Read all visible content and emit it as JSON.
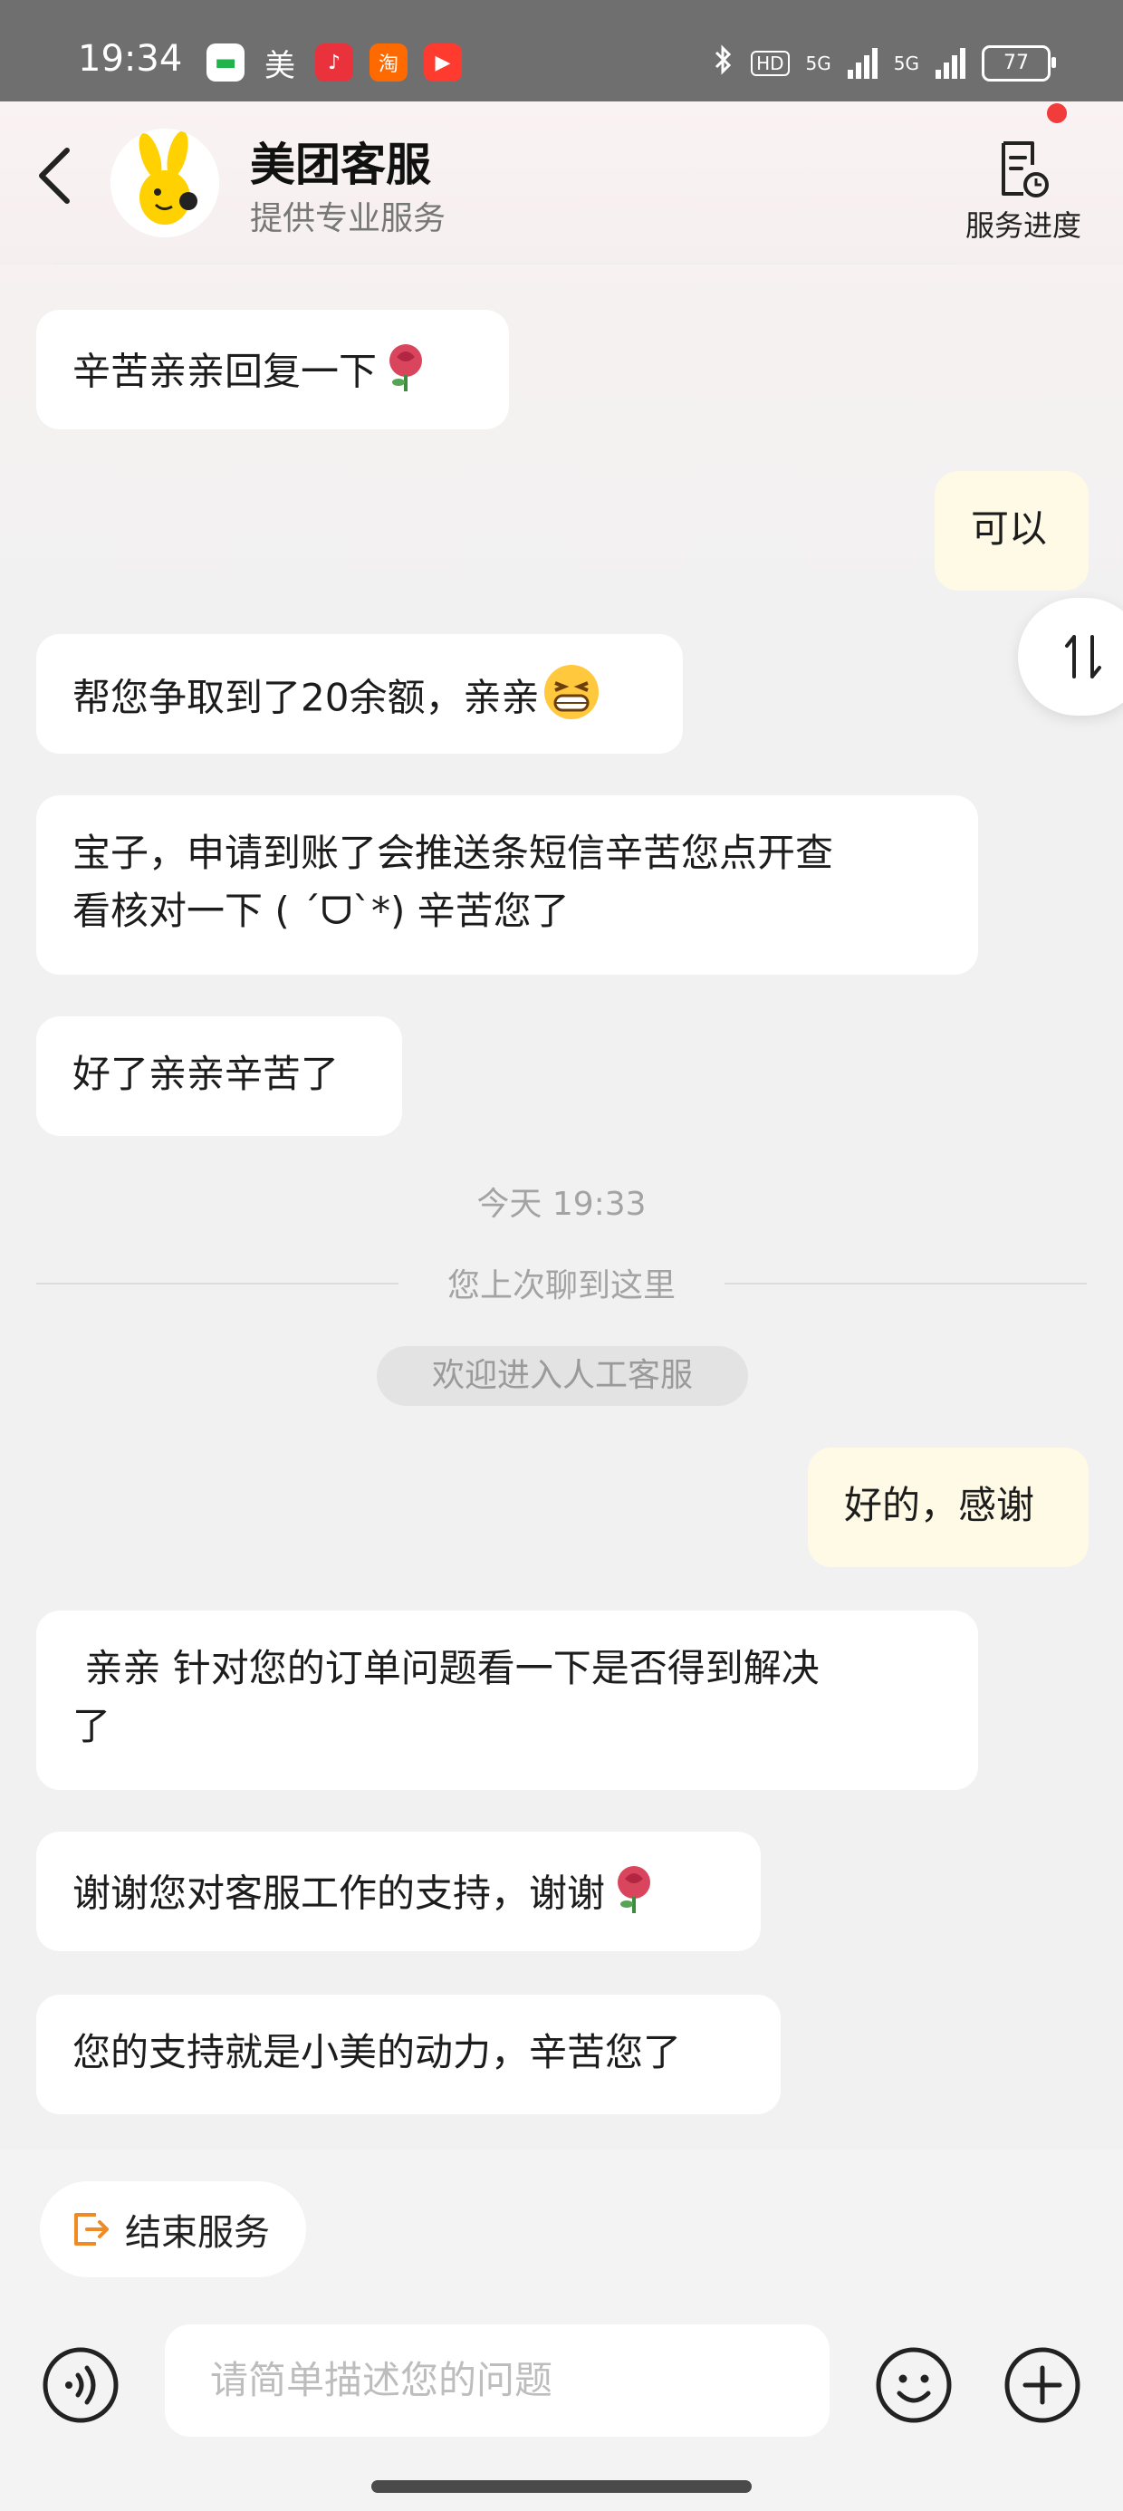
{
  "status_bar": {
    "time": "19:34",
    "app_icons": [
      "wechat-icon",
      "meituan-icon",
      "music-icon",
      "taobao-icon",
      "video-icon"
    ],
    "meituan_glyph": "美",
    "hd_label": "HD",
    "net_label_1": "5G",
    "net_label_2": "5G",
    "battery": "77"
  },
  "header": {
    "title": "美团客服",
    "subtitle": "提供专业服务",
    "progress_label": "服务进度"
  },
  "messages": [
    {
      "side": "agent",
      "text": "辛苦亲亲回复一下",
      "emoji": "rose-icon"
    },
    {
      "side": "me",
      "text": "可以"
    },
    {
      "side": "agent",
      "text": "帮您争取到了20余额，亲亲",
      "emoji": "grin-icon"
    },
    {
      "side": "agent",
      "line1": "宝子，申请到账了会推送条短信辛苦您点开查",
      "line2": "看核对一下 ( ´ᗜ`*) 辛苦您了"
    },
    {
      "side": "agent",
      "text": "好了亲亲辛苦了"
    },
    {
      "side": "me",
      "text": "好的，感谢"
    },
    {
      "side": "agent",
      "line1": " 亲亲 针对您的订单问题看一下是否得到解决",
      "line2": "了"
    },
    {
      "side": "agent",
      "text": "谢谢您对客服工作的支持，谢谢",
      "emoji": "rose-icon"
    },
    {
      "side": "agent",
      "text": "您的支持就是小美的动力，辛苦您了"
    }
  ],
  "system": {
    "time": "今天 19:33",
    "history": "您上次聊到这里",
    "welcome": "欢迎进入人工客服"
  },
  "bottom": {
    "end_service": "结束服务",
    "input_placeholder": "请简单描述您的问题"
  },
  "colors": {
    "my_bubble": "#fefae6",
    "agent_bubble": "#ffffff",
    "accent_orange": "#f08a24",
    "badge_red": "#f23b3b"
  }
}
